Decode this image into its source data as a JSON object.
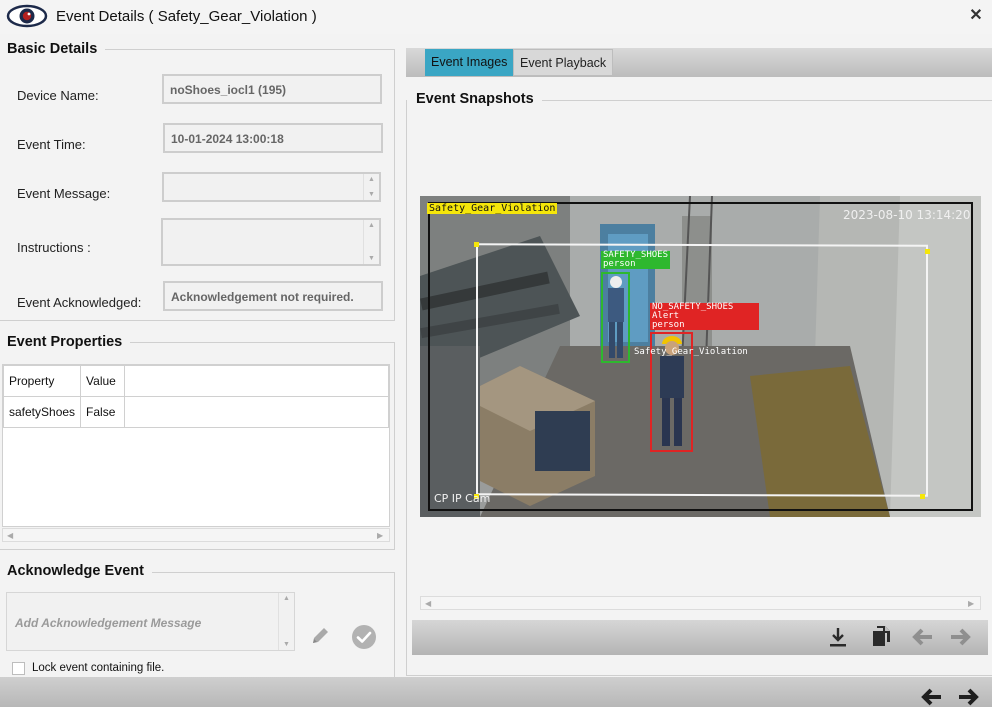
{
  "window": {
    "title": "Event Details ( Safety_Gear_Violation )",
    "close_glyph": "✕",
    "logo_icon": "eye-icon"
  },
  "basic_details": {
    "title": "Basic Details",
    "device_name": {
      "label": "Device Name:",
      "value": "noShoes_iocl1 (195)"
    },
    "event_time": {
      "label": "Event Time:",
      "value": "10-01-2024 13:00:18"
    },
    "event_message": {
      "label": "Event Message:",
      "value": ""
    },
    "instructions": {
      "label": "Instructions :",
      "value": ""
    },
    "event_acknowledged": {
      "label": "Event Acknowledged:",
      "value": "Acknowledgement not required."
    }
  },
  "event_properties": {
    "title": "Event Properties",
    "columns": [
      "Property",
      "Value"
    ],
    "rows": [
      {
        "property": "safetyShoes",
        "value": "False"
      }
    ]
  },
  "acknowledge_event": {
    "title": "Acknowledge Event",
    "message_placeholder": "Add Acknowledgement Message",
    "lock_label": "Lock event containing file.",
    "lock_checked": false,
    "edit_icon": "pencil-icon",
    "confirm_icon": "check-circle-icon"
  },
  "tabs": [
    {
      "label": "Event Images",
      "active": true
    },
    {
      "label": "Event Playback",
      "active": false
    }
  ],
  "snapshots": {
    "title": "Event Snapshots",
    "overlay_label": "Safety_Gear_Violation",
    "timestamp": "2023-08-10 13:14:20",
    "camera_label": "CP IP Cam",
    "detections": [
      {
        "lines": [
          "SAFETY_SHOES",
          "person"
        ],
        "color": "#2eb82e"
      },
      {
        "lines": [
          "NO_SAFETY_SHOES",
          "Alert",
          "person"
        ],
        "color": "#e02424"
      }
    ],
    "zone_label": "Safety_Gear_Violation"
  },
  "image_toolbar": {
    "icons": [
      "download-icon",
      "copy-icon",
      "previous-arrow-icon",
      "next-arrow-icon"
    ]
  },
  "footer": {
    "icons": [
      "previous-arrow-icon",
      "next-arrow-icon"
    ]
  },
  "colors": {
    "accent_tab": "#3aa6c4",
    "detection_green": "#2eb82e",
    "detection_red": "#e02424",
    "overlay_yellow": "#f5e60a"
  }
}
